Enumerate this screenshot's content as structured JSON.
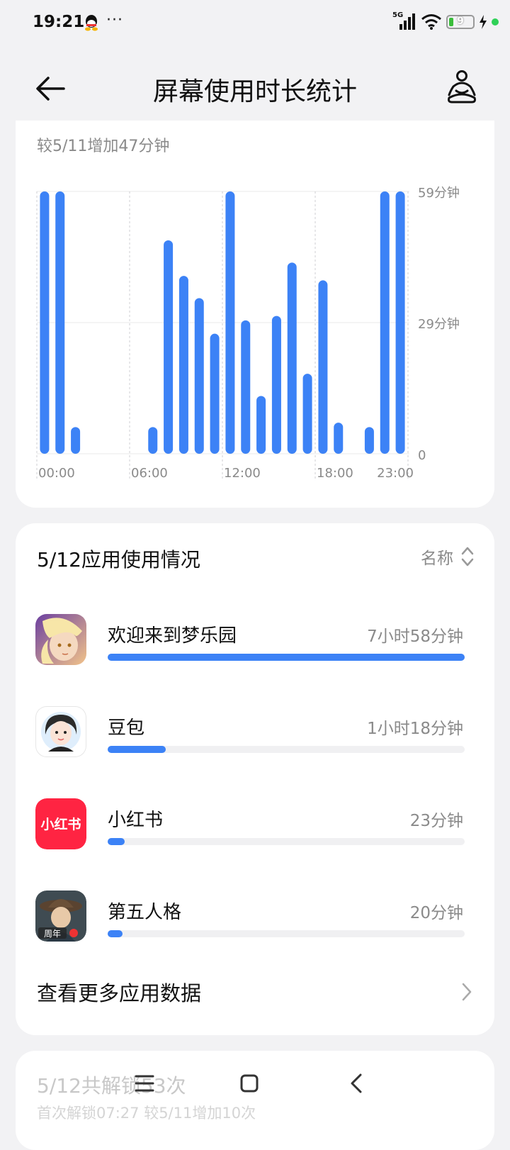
{
  "status_bar": {
    "time": "19:21",
    "overflow": "···",
    "network": "5G",
    "battery": "9"
  },
  "header": {
    "title": "屏幕使用时长统计",
    "back_icon": "back-arrow-icon",
    "right_icon": "meditation-icon"
  },
  "chart_card": {
    "subtitle": "较5/11增加47分钟"
  },
  "chart_data": {
    "type": "bar",
    "y_ticks": [
      "59分钟",
      "29分钟",
      "0"
    ],
    "x_ticks": [
      "00:00",
      "06:00",
      "12:00",
      "18:00",
      "23:00"
    ],
    "ylim": [
      0,
      59
    ],
    "hours": [
      0,
      1,
      2,
      3,
      4,
      5,
      6,
      7,
      8,
      9,
      10,
      11,
      12,
      13,
      14,
      15,
      16,
      17,
      18,
      19,
      20,
      21,
      22,
      23
    ],
    "values": [
      59,
      59,
      6,
      0,
      0,
      0,
      0,
      6,
      48,
      40,
      35,
      27,
      59,
      30,
      13,
      31,
      43,
      18,
      39,
      7,
      0,
      6,
      59,
      59
    ],
    "color": "#3c82f6"
  },
  "usage_card": {
    "title": "5/12应用使用情况",
    "sort_label": "名称",
    "apps": [
      {
        "name": "欢迎来到梦乐园",
        "duration": "7小时58分钟",
        "fraction": 1.0
      },
      {
        "name": "豆包",
        "duration": "1小时18分钟",
        "fraction": 0.163
      },
      {
        "name": "小红书",
        "duration": "23分钟",
        "fraction": 0.048
      },
      {
        "name": "第五人格",
        "duration": "20分钟",
        "fraction": 0.042
      }
    ],
    "xhs_icon_text": "小红书",
    "idv_badge": "周年",
    "more_label": "查看更多应用数据"
  },
  "unlock_card": {
    "title": "5/12共解锁53次",
    "subtitle": "首次解锁07:27 较5/11增加10次"
  },
  "nav": {
    "menu_icon": "menu-icon",
    "home_icon": "home-icon",
    "back_icon": "nav-back-icon"
  }
}
